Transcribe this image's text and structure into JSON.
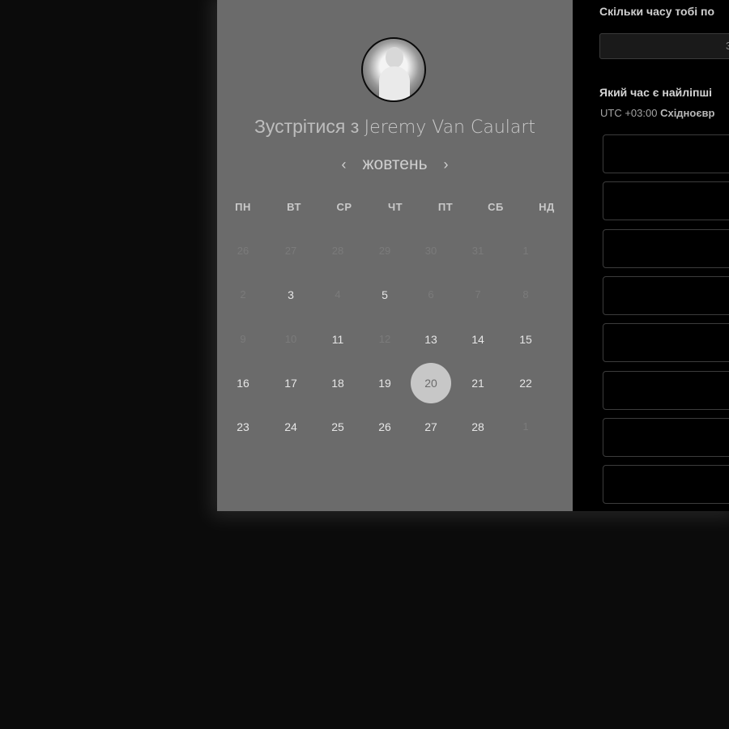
{
  "booking": {
    "title_prefix": "Зустрітися з",
    "host_name": "Jeremy Van Caulart",
    "month": "жовтень",
    "prev_arrow": "‹",
    "next_arrow": "›",
    "weekdays": [
      "ПН",
      "ВТ",
      "СР",
      "ЧТ",
      "ПТ",
      "СБ",
      "НД"
    ],
    "weeks": [
      [
        {
          "d": "26",
          "s": "muted"
        },
        {
          "d": "27",
          "s": "muted"
        },
        {
          "d": "28",
          "s": "muted"
        },
        {
          "d": "29",
          "s": "muted"
        },
        {
          "d": "30",
          "s": "muted"
        },
        {
          "d": "31",
          "s": "muted"
        },
        {
          "d": "1",
          "s": "muted"
        }
      ],
      [
        {
          "d": "2",
          "s": "muted"
        },
        {
          "d": "3",
          "s": "avail"
        },
        {
          "d": "4",
          "s": "muted"
        },
        {
          "d": "5",
          "s": "avail"
        },
        {
          "d": "6",
          "s": "muted"
        },
        {
          "d": "7",
          "s": "muted"
        },
        {
          "d": "8",
          "s": "muted"
        }
      ],
      [
        {
          "d": "9",
          "s": "muted"
        },
        {
          "d": "10",
          "s": "muted"
        },
        {
          "d": "11",
          "s": "avail"
        },
        {
          "d": "12",
          "s": "muted"
        },
        {
          "d": "13",
          "s": "avail"
        },
        {
          "d": "14",
          "s": "avail"
        },
        {
          "d": "15",
          "s": "avail"
        }
      ],
      [
        {
          "d": "16",
          "s": "avail"
        },
        {
          "d": "17",
          "s": "avail"
        },
        {
          "d": "18",
          "s": "avail"
        },
        {
          "d": "19",
          "s": "avail"
        },
        {
          "d": "20",
          "s": "selected"
        },
        {
          "d": "21",
          "s": "avail"
        },
        {
          "d": "22",
          "s": "avail"
        }
      ],
      [
        {
          "d": "23",
          "s": "avail"
        },
        {
          "d": "24",
          "s": "avail"
        },
        {
          "d": "25",
          "s": "avail"
        },
        {
          "d": "26",
          "s": "avail"
        },
        {
          "d": "27",
          "s": "avail"
        },
        {
          "d": "28",
          "s": "avail"
        },
        {
          "d": "1",
          "s": "muted"
        }
      ]
    ],
    "duration_question": "Скільки часу тобі по",
    "duration_value": "3",
    "time_question": "Який час є найліпші",
    "tz_offset": "UTC +03:00",
    "tz_name": "Східноєвр",
    "slot_count": 8
  }
}
